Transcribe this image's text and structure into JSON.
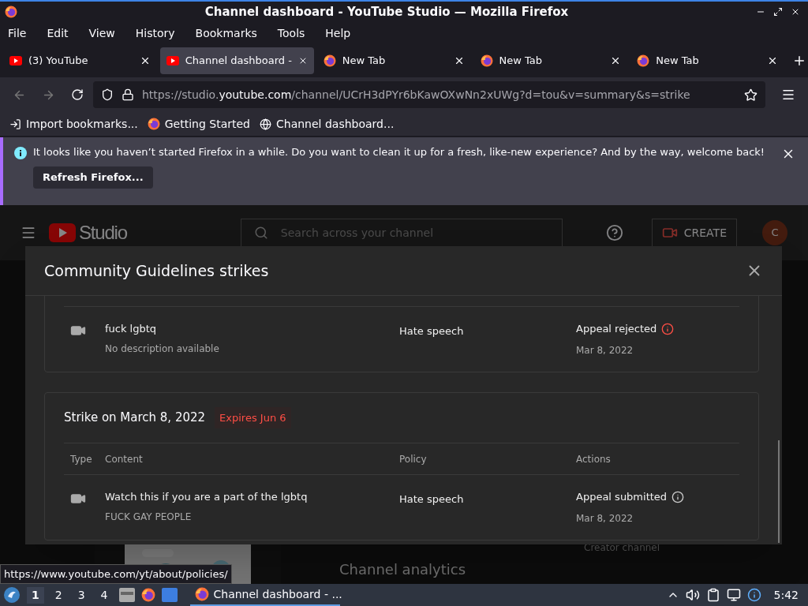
{
  "window": {
    "title": "Channel dashboard - YouTube Studio — Mozilla Firefox"
  },
  "menu": [
    "File",
    "Edit",
    "View",
    "History",
    "Bookmarks",
    "Tools",
    "Help"
  ],
  "tabs": [
    {
      "label": "(3) YouTube",
      "kind": "youtube",
      "selected": false
    },
    {
      "label": "Channel dashboard -",
      "kind": "youtube",
      "selected": true
    },
    {
      "label": "New Tab",
      "kind": "firefox",
      "selected": false
    },
    {
      "label": "New Tab",
      "kind": "firefox",
      "selected": false
    },
    {
      "label": "New Tab",
      "kind": "firefox",
      "selected": false
    }
  ],
  "url": {
    "prefix": "https://studio.",
    "domain": "youtube.com",
    "rest": "/channel/UCrH3dPYr6bKawOXwNn2xUWg?d=tou&v=summary&s=strike"
  },
  "bookmarks": [
    {
      "label": "Import bookmarks...",
      "kind": "import"
    },
    {
      "label": "Getting Started",
      "kind": "firefox"
    },
    {
      "label": "Channel dashboard...",
      "kind": "globe"
    }
  ],
  "notification": {
    "message": "It looks like you haven’t started Firefox in a while. Do you want to clean it up for a fresh, like-new experience? And by the way, welcome back!",
    "button": "Refresh Firefox..."
  },
  "studio": {
    "logo": "Studio",
    "search_placeholder": "Search across your channel",
    "create": "CREATE",
    "avatar": "C",
    "analytics": "Channel analytics",
    "creator": "Creator channel"
  },
  "modal": {
    "title": "Community Guidelines strikes",
    "strikes": [
      {
        "rows": [
          {
            "content": "fuck lgbtq",
            "description": "No description available",
            "policy": "Hate speech",
            "action": "Appeal rejected",
            "kind": "rejected",
            "date": "Mar 8, 2022"
          }
        ]
      },
      {
        "title": "Strike on March 8, 2022",
        "expires": "Expires Jun 6",
        "columns": [
          "Type",
          "Content",
          "Policy",
          "Actions"
        ],
        "rows": [
          {
            "content": "Watch this if you are a part of the lgbtq",
            "description": "FUCK GAY PEOPLE",
            "policy": "Hate speech",
            "action": "Appeal submitted",
            "kind": "submitted",
            "date": "Mar 8, 2022"
          }
        ]
      }
    ]
  },
  "status_link": "https://www.youtube.com/yt/about/policies/",
  "taskbar": {
    "workspaces": [
      {
        "label": "1",
        "selected": true
      },
      {
        "label": "2",
        "selected": false
      },
      {
        "label": "3",
        "selected": false
      },
      {
        "label": "4",
        "selected": false
      }
    ],
    "task": "Channel dashboard - ...",
    "clock": "5:42"
  }
}
